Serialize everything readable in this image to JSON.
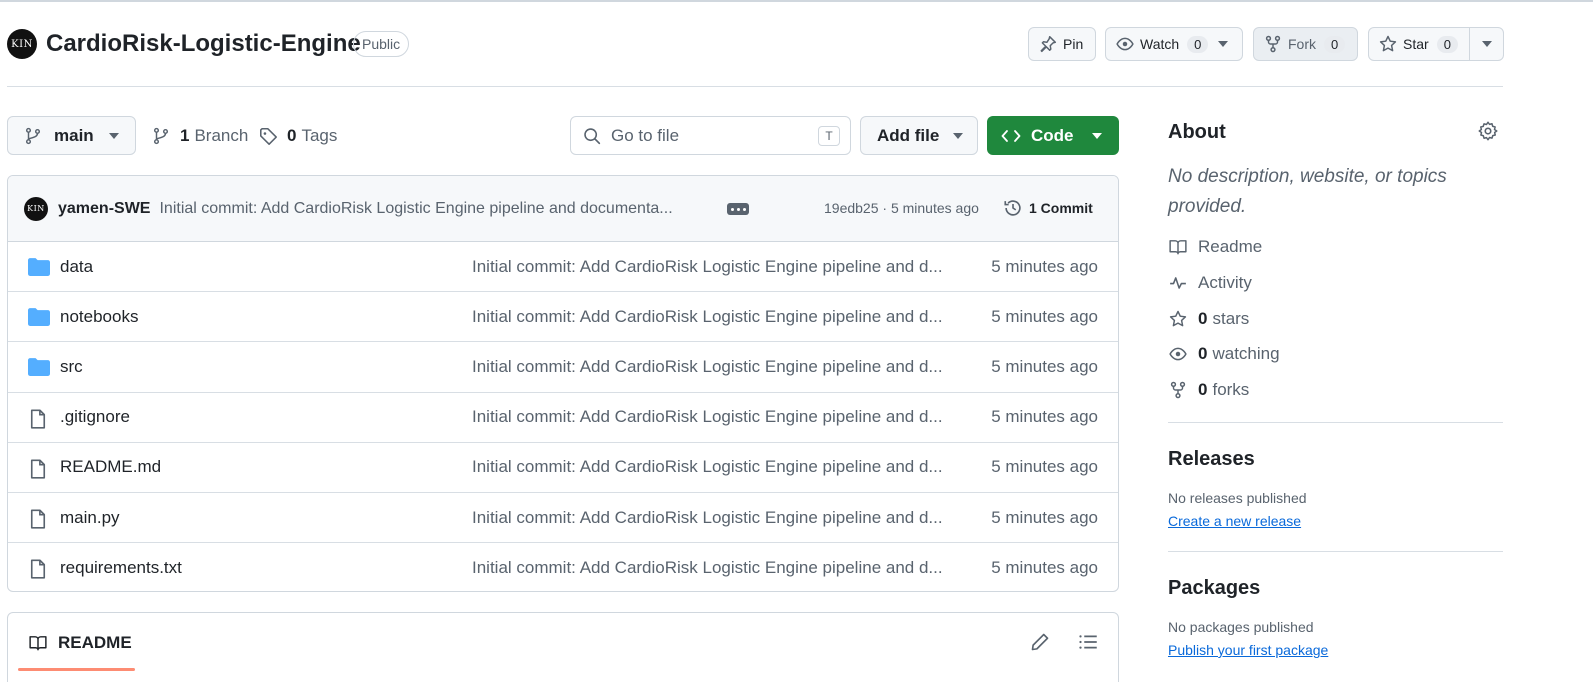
{
  "repo": {
    "owner_avatar_text": "KIN",
    "name": "CardioRisk-Logistic-Engine",
    "visibility": "Public"
  },
  "actions": {
    "pin_label": "Pin",
    "watch_label": "Watch",
    "watch_count": "0",
    "fork_label": "Fork",
    "fork_count": "0",
    "star_label": "Star",
    "star_count": "0"
  },
  "branch_bar": {
    "branch_name": "main",
    "branches_count": "1",
    "branches_label": "Branch",
    "tags_count": "0",
    "tags_label": "Tags",
    "search_placeholder": "Go to file",
    "search_shortcut": "T",
    "add_file_label": "Add file",
    "code_label": "Code"
  },
  "latest_commit": {
    "author_avatar_text": "KIN",
    "author": "yamen-SWE",
    "message": "Initial commit: Add CardioRisk Logistic Engine pipeline and documenta...",
    "sha_time": "19edb25 · 5 minutes ago",
    "commit_count_label": "1 Commit"
  },
  "files": [
    {
      "name": "data",
      "type": "folder",
      "message": "Initial commit: Add CardioRisk Logistic Engine pipeline and d...",
      "time": "5 minutes ago"
    },
    {
      "name": "notebooks",
      "type": "folder",
      "message": "Initial commit: Add CardioRisk Logistic Engine pipeline and d...",
      "time": "5 minutes ago"
    },
    {
      "name": "src",
      "type": "folder",
      "message": "Initial commit: Add CardioRisk Logistic Engine pipeline and d...",
      "time": "5 minutes ago"
    },
    {
      "name": ".gitignore",
      "type": "file",
      "message": "Initial commit: Add CardioRisk Logistic Engine pipeline and d...",
      "time": "5 minutes ago"
    },
    {
      "name": "README.md",
      "type": "file",
      "message": "Initial commit: Add CardioRisk Logistic Engine pipeline and d...",
      "time": "5 minutes ago"
    },
    {
      "name": "main.py",
      "type": "file",
      "message": "Initial commit: Add CardioRisk Logistic Engine pipeline and d...",
      "time": "5 minutes ago"
    },
    {
      "name": "requirements.txt",
      "type": "file",
      "message": "Initial commit: Add CardioRisk Logistic Engine pipeline and d...",
      "time": "5 minutes ago"
    }
  ],
  "readme_panel": {
    "tab_label": "README"
  },
  "sidebar": {
    "about_heading": "About",
    "about_description": "No description, website, or topics provided.",
    "readme_label": "Readme",
    "activity_label": "Activity",
    "stars_count": "0",
    "stars_label": "stars",
    "watching_count": "0",
    "watching_label": "watching",
    "forks_count": "0",
    "forks_label": "forks",
    "releases_heading": "Releases",
    "releases_empty": "No releases published",
    "releases_link": "Create a new release",
    "packages_heading": "Packages",
    "packages_empty": "No packages published",
    "packages_link": "Publish your first package"
  },
  "colors": {
    "accent_green": "#1f883d",
    "folder_blue": "#54aeff",
    "link_blue": "#0969da",
    "muted_text": "#59636e",
    "border": "#d0d7de",
    "readme_underline": "#fd8c73"
  }
}
